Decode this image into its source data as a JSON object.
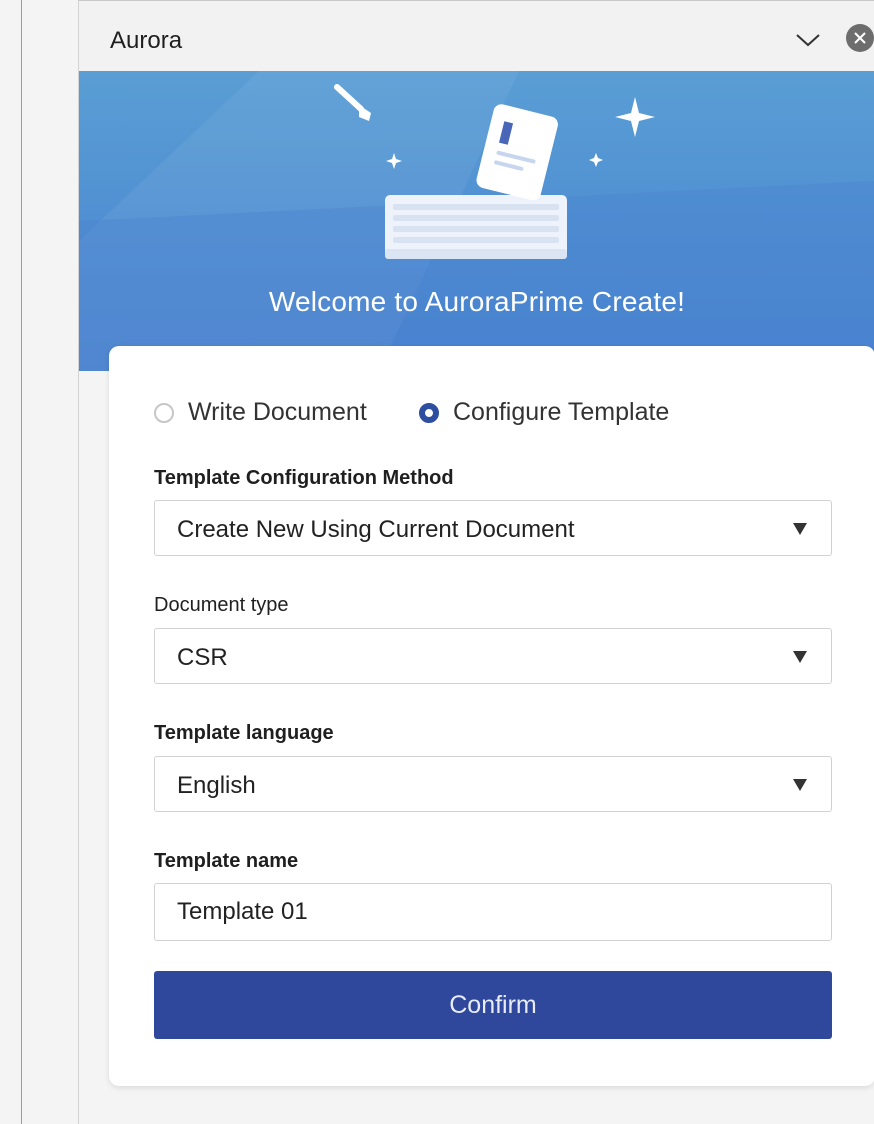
{
  "panel": {
    "title": "Aurora"
  },
  "banner": {
    "welcome": "Welcome to AuroraPrime Create!"
  },
  "mode": {
    "options": [
      {
        "label": "Write Document",
        "selected": false
      },
      {
        "label": "Configure Template",
        "selected": true
      }
    ]
  },
  "form": {
    "method_label": "Template Configuration Method",
    "method_value": "Create New Using Current Document",
    "doctype_label": "Document type",
    "doctype_value": "CSR",
    "language_label": "Template language",
    "language_value": "English",
    "name_label": "Template name",
    "name_value": "Template 01"
  },
  "actions": {
    "confirm_label": "Confirm"
  },
  "colors": {
    "banner": "#4c8ad2",
    "primary": "#30489c",
    "radio_checked": "#2e4fa0"
  }
}
